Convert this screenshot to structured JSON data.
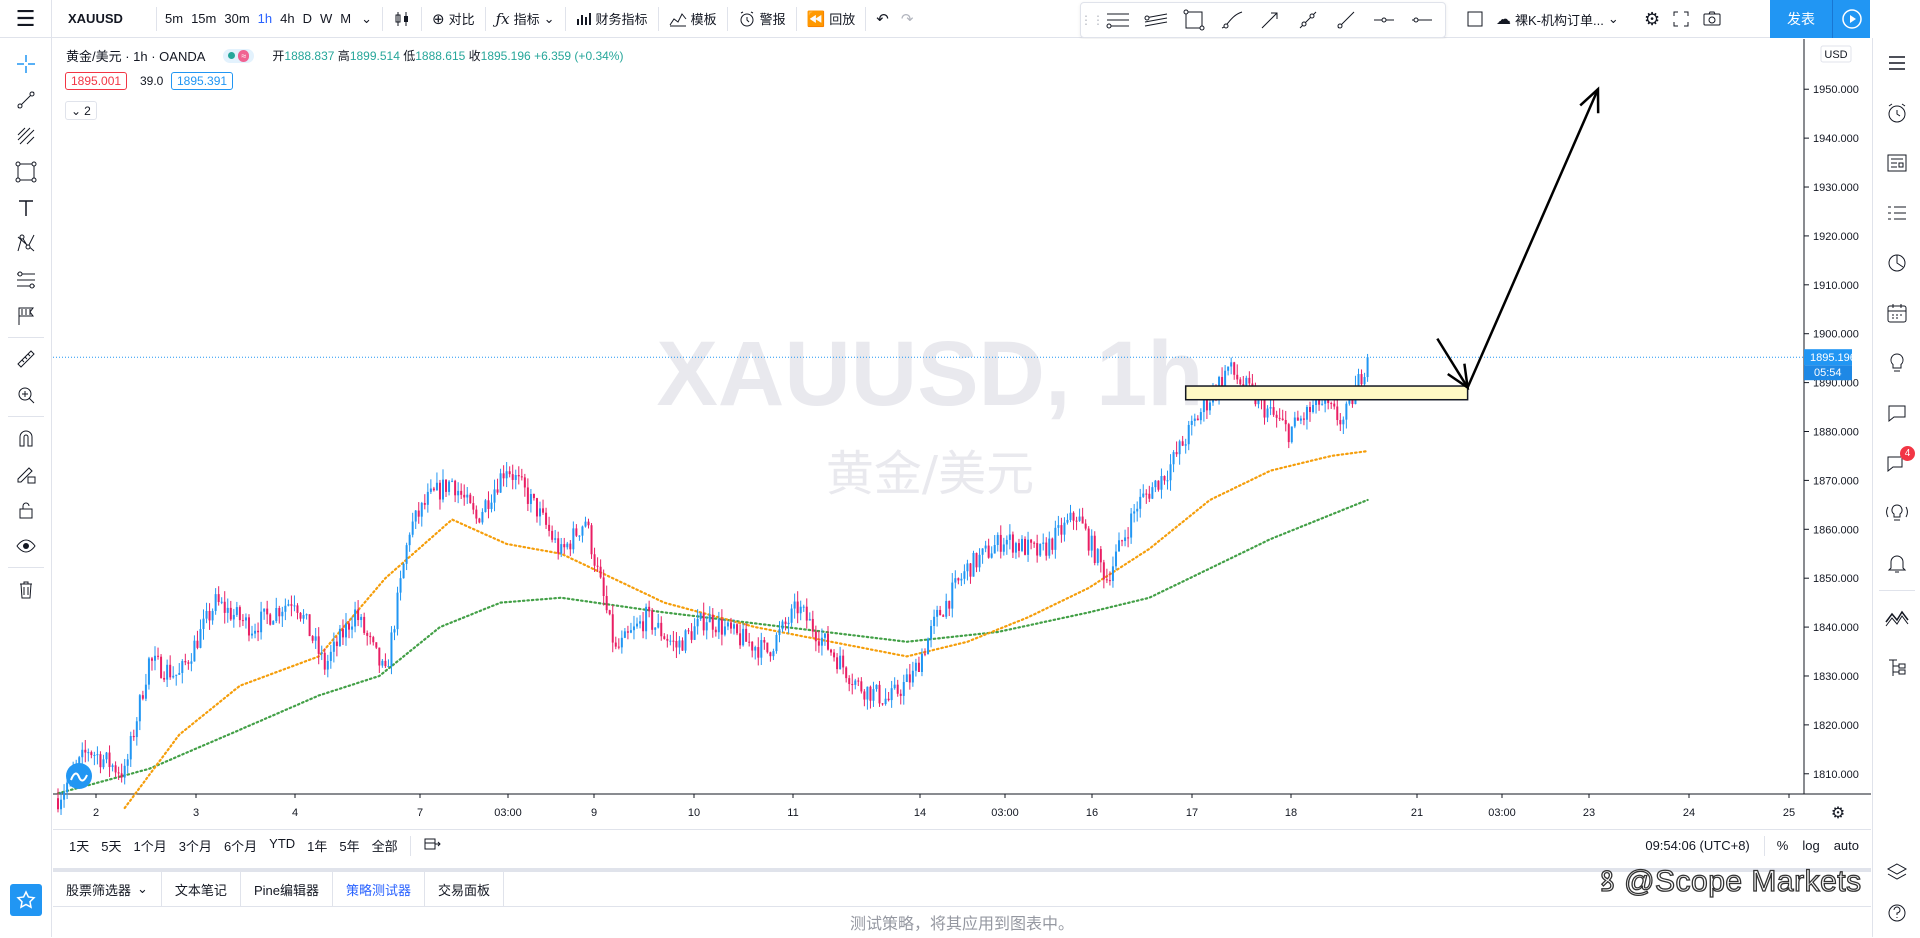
{
  "topbar": {
    "symbol": "XAUUSD",
    "intervals": [
      "5m",
      "15m",
      "30m",
      "1h",
      "4h",
      "D",
      "W",
      "M"
    ],
    "active_interval": "1h",
    "compare": "对比",
    "indicators": "指标",
    "financials": "财务指标",
    "templates": "模板",
    "alert": "警报",
    "replay": "回放",
    "layout_name": "裸K-机构订单...",
    "publish": "发表"
  },
  "legend": {
    "title": "黄金/美元 · 1h · OANDA",
    "open_label": "开",
    "open": "1888.837",
    "high_label": "高",
    "high": "1899.514",
    "low_label": "低",
    "low": "1888.615",
    "close_label": "收",
    "close": "1895.196",
    "change": "+6.359 (+0.34%)",
    "bid": "1895.001",
    "spread": "39.0",
    "ask": "1895.391",
    "collapse": "2"
  },
  "watermark": {
    "line1": "XAUUSD, 1h",
    "line2": "黄金/美元"
  },
  "price_axis": {
    "currency": "USD",
    "ticks": [
      "1950.000",
      "1940.000",
      "1930.000",
      "1920.000",
      "1910.000",
      "1900.000",
      "1890.000",
      "1880.000",
      "1870.000",
      "1860.000",
      "1850.000",
      "1840.000",
      "1830.000",
      "1820.000",
      "1810.000"
    ],
    "last_price": "1895.196",
    "countdown": "05:54"
  },
  "time_axis": {
    "ticks": [
      "2",
      "3",
      "4",
      "7",
      "03:00",
      "9",
      "10",
      "11",
      "14",
      "03:00",
      "16",
      "17",
      "18",
      "21",
      "03:00",
      "23",
      "24",
      "25"
    ]
  },
  "bottombar": {
    "ranges": [
      "1天",
      "5天",
      "1个月",
      "3个月",
      "6个月",
      "YTD",
      "1年",
      "5年",
      "全部"
    ],
    "clock": "09:54:06 (UTC+8)",
    "percent": "%",
    "log": "log",
    "auto": "auto"
  },
  "panel": {
    "tabs": [
      "股票筛选器",
      "文本笔记",
      "Pine编辑器",
      "策略测试器",
      "交易面板"
    ],
    "active_tab": "策略测试器",
    "message": "测试策略，将其应用到图表中。"
  },
  "right_badge": "4",
  "brand": "@Scope Markets",
  "colors": {
    "up": "#2196f3",
    "down": "#e91e63",
    "ma_fast": "#f59e0b",
    "ma_slow": "#43a047",
    "accent": "#2962ff"
  },
  "chart_data": {
    "type": "candlestick",
    "symbol": "XAUUSD",
    "interval": "1h",
    "ylim": [
      1803,
      1957
    ],
    "y_ticks": [
      1810,
      1820,
      1830,
      1840,
      1850,
      1860,
      1870,
      1880,
      1890,
      1900,
      1910,
      1920,
      1930,
      1940,
      1950
    ],
    "last_price": 1895.196,
    "price_path": [
      [
        0,
        1805
      ],
      [
        10,
        1815
      ],
      [
        22,
        1810
      ],
      [
        30,
        1833
      ],
      [
        40,
        1830
      ],
      [
        52,
        1845
      ],
      [
        64,
        1840
      ],
      [
        78,
        1846
      ],
      [
        88,
        1832
      ],
      [
        98,
        1843
      ],
      [
        108,
        1830
      ],
      [
        116,
        1860
      ],
      [
        122,
        1866
      ],
      [
        130,
        1870
      ],
      [
        138,
        1862
      ],
      [
        148,
        1873
      ],
      [
        158,
        1864
      ],
      [
        166,
        1855
      ],
      [
        174,
        1862
      ],
      [
        184,
        1835
      ],
      [
        194,
        1842
      ],
      [
        204,
        1836
      ],
      [
        214,
        1842
      ],
      [
        224,
        1838
      ],
      [
        234,
        1835
      ],
      [
        244,
        1844
      ],
      [
        254,
        1836
      ],
      [
        264,
        1828
      ],
      [
        274,
        1825
      ],
      [
        282,
        1830
      ],
      [
        290,
        1842
      ],
      [
        300,
        1852
      ],
      [
        312,
        1858
      ],
      [
        324,
        1855
      ],
      [
        336,
        1863
      ],
      [
        346,
        1850
      ],
      [
        356,
        1865
      ],
      [
        366,
        1872
      ],
      [
        376,
        1883
      ],
      [
        386,
        1893
      ],
      [
        396,
        1886
      ],
      [
        406,
        1880
      ],
      [
        416,
        1886
      ],
      [
        424,
        1882
      ],
      [
        432,
        1895
      ]
    ],
    "ma_fast_path": [
      [
        22,
        1803
      ],
      [
        40,
        1818
      ],
      [
        60,
        1828
      ],
      [
        86,
        1834
      ],
      [
        108,
        1850
      ],
      [
        130,
        1862
      ],
      [
        148,
        1857
      ],
      [
        166,
        1855
      ],
      [
        200,
        1845
      ],
      [
        230,
        1840
      ],
      [
        280,
        1834
      ],
      [
        300,
        1837
      ],
      [
        320,
        1842
      ],
      [
        340,
        1848
      ],
      [
        360,
        1856
      ],
      [
        380,
        1866
      ],
      [
        400,
        1872
      ],
      [
        420,
        1875
      ],
      [
        432,
        1876
      ]
    ],
    "ma_slow_path": [
      [
        0,
        1806
      ],
      [
        30,
        1811
      ],
      [
        60,
        1819
      ],
      [
        86,
        1826
      ],
      [
        106,
        1830
      ],
      [
        126,
        1840
      ],
      [
        146,
        1845
      ],
      [
        166,
        1846
      ],
      [
        200,
        1843
      ],
      [
        240,
        1840
      ],
      [
        280,
        1837
      ],
      [
        310,
        1839
      ],
      [
        340,
        1843
      ],
      [
        360,
        1846
      ],
      [
        380,
        1852
      ],
      [
        400,
        1858
      ],
      [
        420,
        1863
      ],
      [
        432,
        1866
      ]
    ],
    "zone": {
      "from_bar": 372,
      "to_bar": 465,
      "low": 1886.5,
      "high": 1889.3
    },
    "arrows": [
      {
        "from": [
          455,
          1899
        ],
        "to": [
          465,
          1889
        ]
      },
      {
        "from": [
          465,
          1889
        ],
        "to": [
          508,
          1950
        ]
      }
    ]
  }
}
